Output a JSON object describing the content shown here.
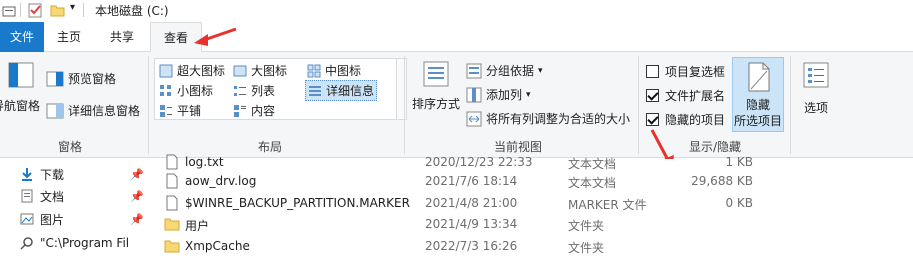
{
  "window": {
    "title": "本地磁盘 (C:)"
  },
  "tabs": {
    "file": "文件",
    "home": "主页",
    "share": "共享",
    "view": "查看"
  },
  "ribbon": {
    "panes": {
      "nav_pane": "导航窗格",
      "preview": "预览窗格",
      "details": "详细信息窗格",
      "group": "窗格"
    },
    "layout": {
      "xl_icons": "超大图标",
      "l_icons": "大图标",
      "m_icons": "中图标",
      "s_icons": "小图标",
      "list": "列表",
      "details": "详细信息",
      "tiles": "平铺",
      "content": "内容",
      "group": "布局"
    },
    "current_view": {
      "sort": "排序方式",
      "group_by": "分组依据",
      "add_col": "添加列",
      "fit_cols": "将所有列调整为合适的大小",
      "group": "当前视图"
    },
    "show_hide": {
      "item_checkboxes": "项目复选框",
      "file_ext": "文件扩展名",
      "hidden_items": "隐藏的项目",
      "hide_selected_1": "隐藏",
      "hide_selected_2": "所选项目",
      "group": "显示/隐藏"
    },
    "options": "选项"
  },
  "nav": [
    "下载",
    "文档",
    "图片",
    "\"C:\\Program Fil"
  ],
  "files": [
    {
      "name": "log.txt",
      "date": "2020/12/23 22:33",
      "type": "文本文档",
      "size": "1 KB"
    },
    {
      "name": "aow_drv.log",
      "date": "2021/7/6 18:14",
      "type": "文本文档",
      "size": "29,688 KB"
    },
    {
      "name": "$WINRE_BACKUP_PARTITION.MARKER",
      "date": "2021/4/8 21:00",
      "type": "MARKER 文件",
      "size": "0 KB"
    },
    {
      "name": "用户",
      "date": "2021/4/9 13:34",
      "type": "文件夹",
      "size": ""
    },
    {
      "name": "XmpCache",
      "date": "2022/7/3 16:26",
      "type": "文件夹",
      "size": ""
    }
  ],
  "colors": {
    "accent": "#1979ca",
    "annotation": "#e8322f",
    "folder": "#f8d775"
  }
}
